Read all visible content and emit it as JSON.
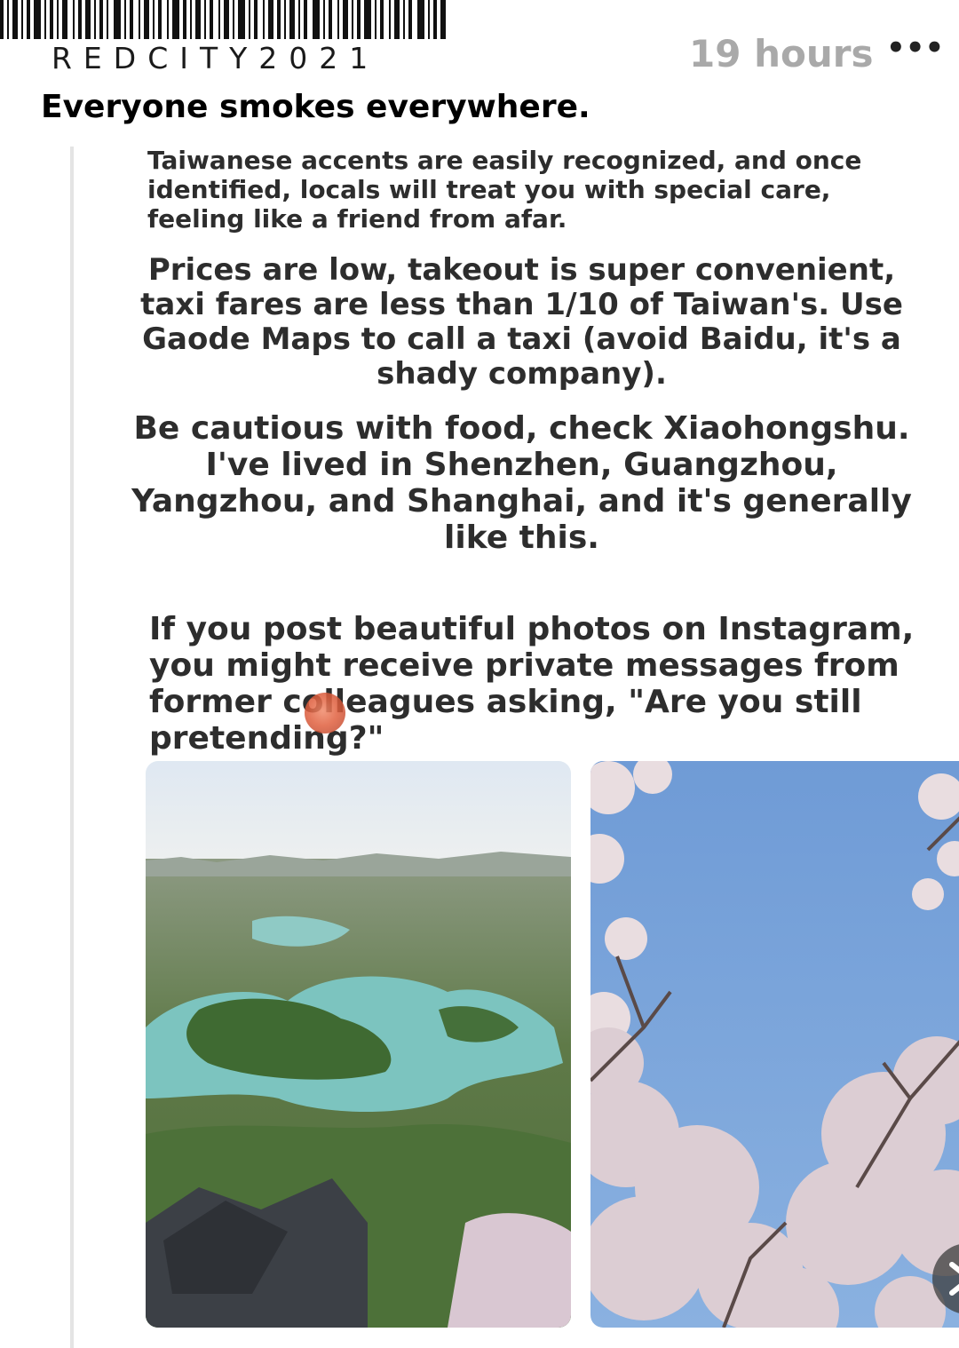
{
  "header": {
    "watermark": "REDCITY2021",
    "timestamp": "19 hours",
    "more_label": "•••"
  },
  "post": {
    "title": "Everyone smokes everywhere.",
    "paragraphs": [
      "Taiwanese accents are easily recognized, and once identified, locals will treat you with special care, feeling like a friend from afar.",
      "Prices are low, takeout is super convenient, taxi fares are less than 1/10 of Taiwan's. Use Gaode Maps to call a taxi (avoid Baidu, it's a shady company).",
      "Be cautious with food, check Xiaohongshu. I've lived in Shenzhen, Guangzhou, Yangzhou, and Shanghai, and it's generally like this.",
      "If you post beautiful photos on Instagram, you might receive private messages from former colleagues asking, \"Are you still pretending?\""
    ]
  },
  "photos": [
    {
      "subject": "aerial-lake-garden"
    },
    {
      "subject": "cherry-blossom-sky"
    }
  ],
  "colors": {
    "timestamp": "#a9a9a9",
    "body_text": "#2d2d2d",
    "sky": "#6f9bd6",
    "lake": "#7cc4bf"
  }
}
